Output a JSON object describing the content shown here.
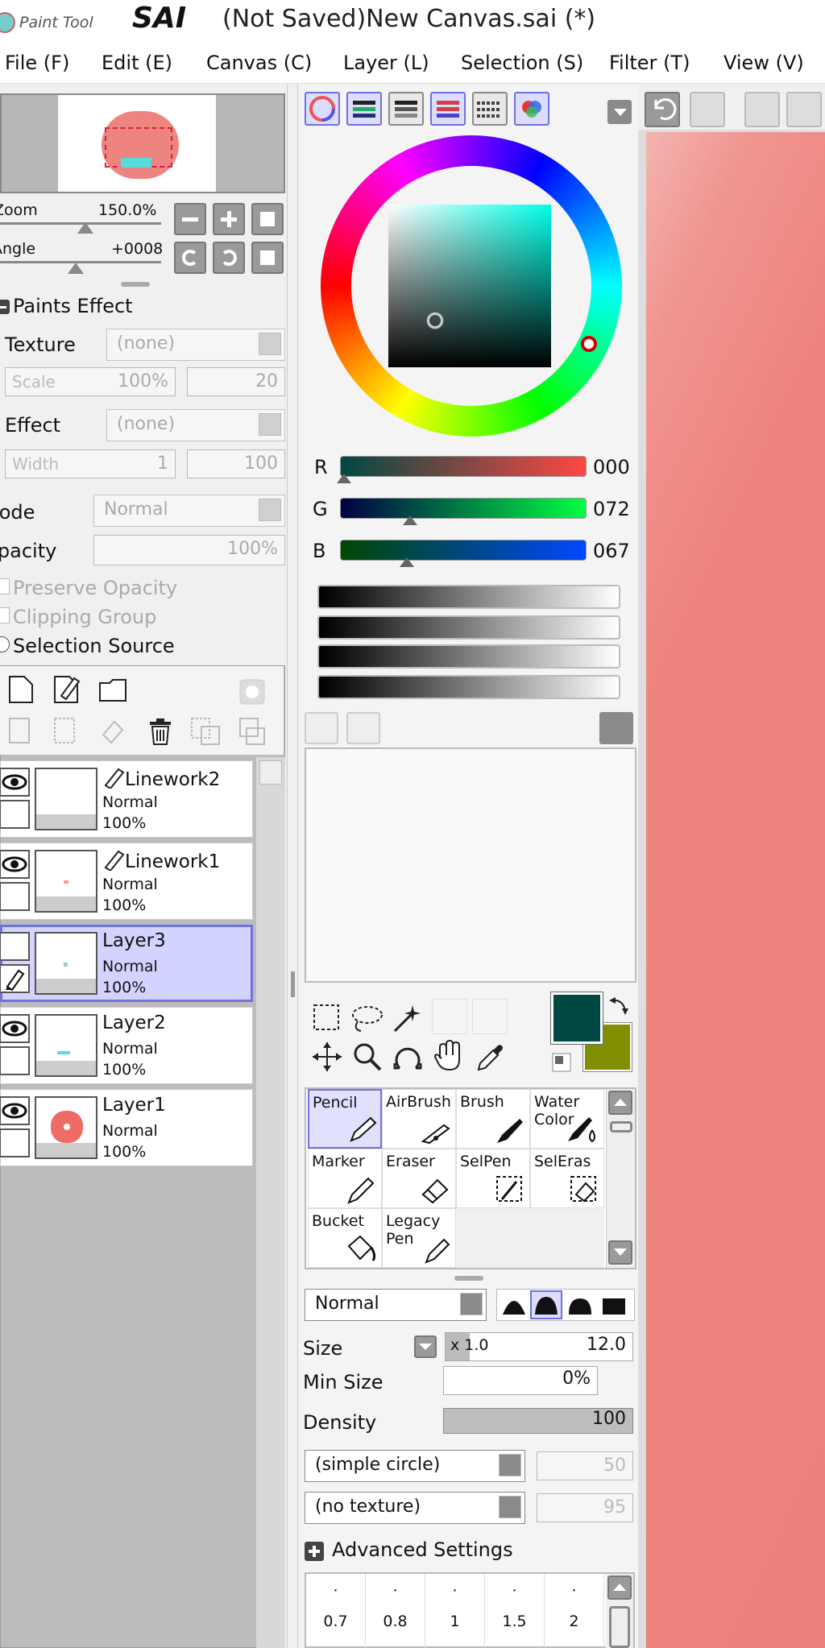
{
  "window": {
    "title": "(Not Saved)New Canvas.sai (*)",
    "logo_text": "PaintTool SAI"
  },
  "menu": [
    "File (F)",
    "Edit (E)",
    "Canvas (C)",
    "Layer (L)",
    "Selection (S)",
    "Filter (T)",
    "View (V)"
  ],
  "navigator": {
    "zoom_label": "Zoom",
    "zoom_value": "150.0%",
    "angle_label": "Angle",
    "angle_value": "+0008"
  },
  "paints_effect": {
    "header": "Paints Effect",
    "texture_label": "Texture",
    "texture_value": "(none)",
    "scale_label": "Scale",
    "scale_value": "100%",
    "scale_amount": "20",
    "effect_label": "Effect",
    "effect_value": "(none)",
    "width_label": "Width",
    "width_value": "1",
    "width_amount": "100"
  },
  "layer_props": {
    "mode_label": "Mode",
    "mode_value": "Normal",
    "opacity_label": "Opacity",
    "opacity_value": "100%",
    "preserve_opacity": "Preserve Opacity",
    "clipping_group": "Clipping Group",
    "selection_source": "Selection Source"
  },
  "layers": [
    {
      "name": "Linework2",
      "mode": "Normal",
      "opacity": "100%",
      "visible": true,
      "selected": false
    },
    {
      "name": "Linework1",
      "mode": "Normal",
      "opacity": "100%",
      "visible": true,
      "selected": false
    },
    {
      "name": "Layer3",
      "mode": "Normal",
      "opacity": "100%",
      "visible": false,
      "selected": true
    },
    {
      "name": "Layer2",
      "mode": "Normal",
      "opacity": "100%",
      "visible": true,
      "selected": false
    },
    {
      "name": "Layer1",
      "mode": "Normal",
      "opacity": "100%",
      "visible": true,
      "selected": false
    }
  ],
  "color": {
    "r_label": "R",
    "r_value": "000",
    "g_label": "G",
    "g_value": "072",
    "b_label": "B",
    "b_value": "067",
    "foreground": "#004843",
    "background": "#7f8f00"
  },
  "tools": [
    {
      "label": "Pencil",
      "selected": true
    },
    {
      "label": "AirBrush",
      "selected": false
    },
    {
      "label": "Brush",
      "selected": false
    },
    {
      "label": "Water Color",
      "selected": false
    },
    {
      "label": "Marker",
      "selected": false
    },
    {
      "label": "Eraser",
      "selected": false
    },
    {
      "label": "SelPen",
      "selected": false
    },
    {
      "label": "SelEras",
      "selected": false
    },
    {
      "label": "Bucket",
      "selected": false
    },
    {
      "label": "Legacy Pen",
      "selected": false
    }
  ],
  "brush": {
    "blend_mode": "Normal",
    "size_label": "Size",
    "size_multiplier": "x 1.0",
    "size_value": "12.0",
    "min_size_label": "Min Size",
    "min_size_value": "0%",
    "density_label": "Density",
    "density_value": "100",
    "shape": "(simple circle)",
    "shape_value": "50",
    "texture": "(no texture)",
    "texture_value": "95",
    "advanced": "Advanced Settings",
    "presets": [
      "0.7",
      "0.8",
      "1",
      "1.5",
      "2"
    ]
  }
}
